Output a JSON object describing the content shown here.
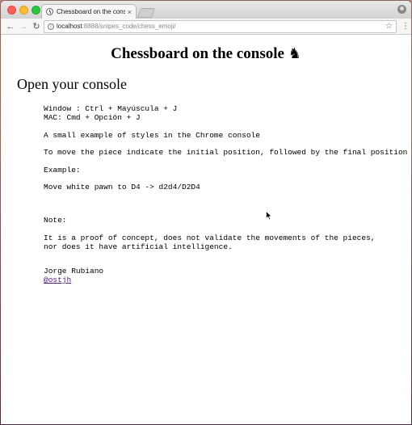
{
  "browser": {
    "tab_title": "Chessboard on the console ♞",
    "tab_close": "×",
    "url_host": "localhost",
    "url_path": ":8888/snipes_code/chess_emoji/"
  },
  "page": {
    "title": "Chessboard on the console",
    "title_glyph": "♞",
    "subtitle": "Open your console",
    "shortcut_windows": "Window : Ctrl + Mayúscula + J",
    "shortcut_mac": "MAC: Cmd + Opción + J",
    "styles_note": "A small example of styles in the Chrome console",
    "move_instructions": "To move the piece indicate the initial position, followed by the final position",
    "example_label": "Example:",
    "example_move": "Move white pawn to D4 -> d2d4/D2D4",
    "note_label": "Note:",
    "note_line1": "It is a proof of concept, does not validate the movements of the pieces,",
    "note_line2": "nor does it have artificial intelligence.",
    "author": "Jorge Rubiano",
    "author_link": "@ostjh"
  },
  "colors": {
    "link": "#551a8b",
    "close": "#fc5f57",
    "minimize": "#fdbc2e",
    "maximize": "#28c840"
  },
  "icons": [
    "close-icon",
    "minimize-icon",
    "maximize-icon",
    "favicon-icon",
    "back-icon",
    "forward-icon",
    "reload-icon",
    "info-icon",
    "star-icon",
    "menu-icon",
    "profile-icon",
    "cursor-icon"
  ]
}
